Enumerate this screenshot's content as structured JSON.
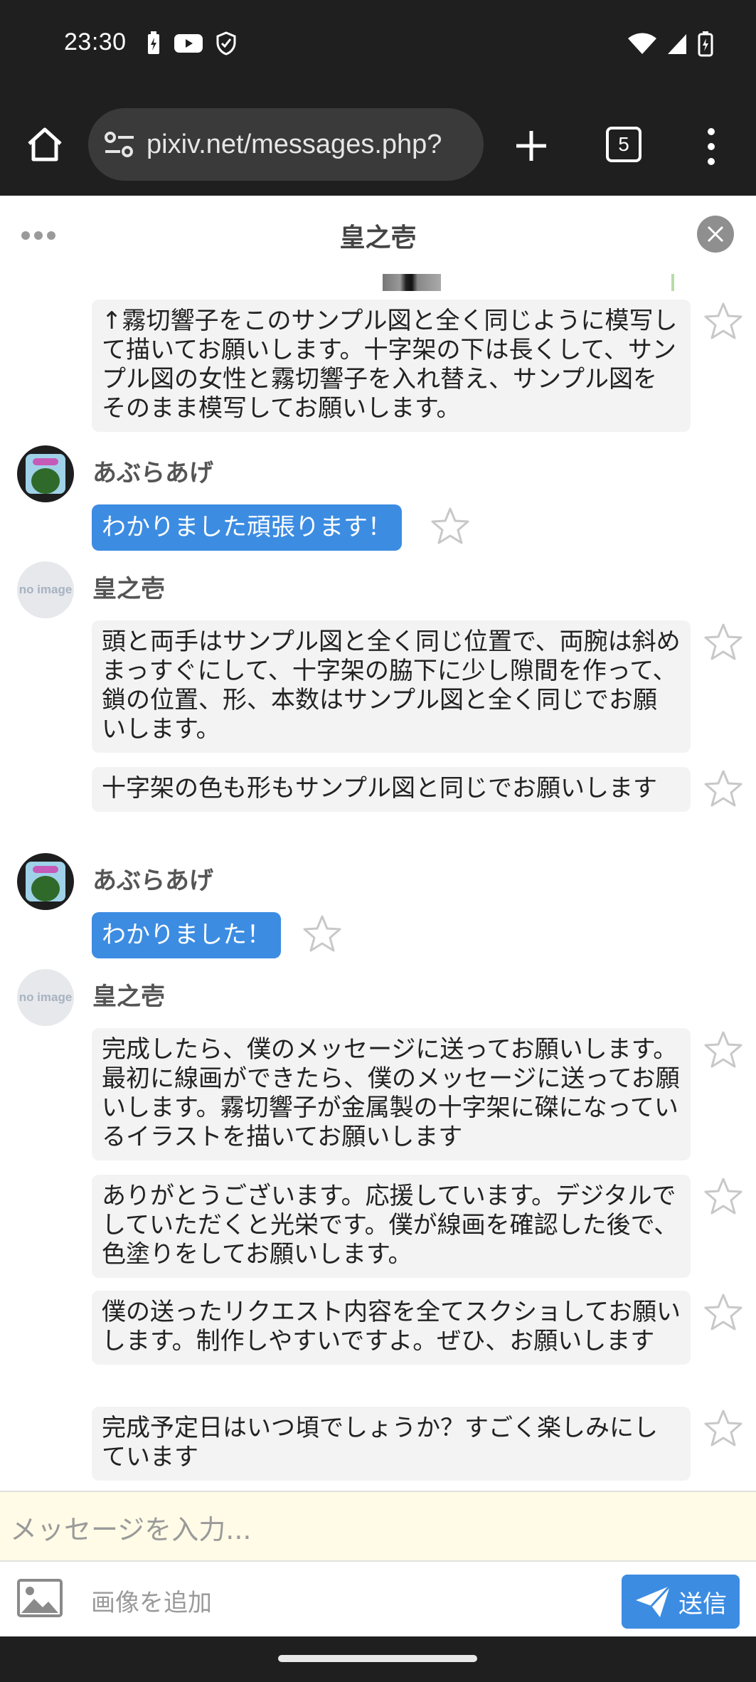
{
  "status_bar": {
    "time": "23:30"
  },
  "browser": {
    "url": "pixiv.net/messages.php?",
    "tab_count": "5"
  },
  "chat": {
    "title": "皇之壱"
  },
  "messages": [
    {
      "text": "↑霧切響子をこのサンプル図と全く同じように模写して描いてお願いします。十字架の下は長くして、サンプル図の女性と霧切響子を入れ替え、サンプル図をそのまま模写してお願いします。"
    },
    {
      "user": "あぶらあげ",
      "text": "わかりました頑張ります！"
    },
    {
      "user": "皇之壱",
      "text": "頭と両手はサンプル図と全く同じ位置で、両腕は斜めまっすぐにして、十字架の脇下に少し隙間を作って、鎖の位置、形、本数はサンプル図と全く同じでお願いします。"
    },
    {
      "text": "十字架の色も形もサンプル図と同じでお願いします"
    },
    {
      "user": "あぶらあげ",
      "text": "わかりました！"
    },
    {
      "user": "皇之壱",
      "text": "完成したら、僕のメッセージに送ってお願いします。最初に線画ができたら、僕のメッセージに送ってお願いします。霧切響子が金属製の十字架に磔になっているイラストを描いてお願いします"
    },
    {
      "text": "ありがとうございます。応援しています。デジタルでしていただくと光栄です。僕が線画を確認した後で、色塗りをしてお願いします。"
    },
    {
      "text": "僕の送ったリクエスト内容を全てスクショしてお願いします。制作しやすいですよ。ぜひ、お願いします"
    },
    {
      "text": "完成予定日はいつ頃でしょうか？すごく楽しみにしています"
    }
  ],
  "avatar_placeholder": "no image",
  "composer": {
    "placeholder": "メッセージを入力...",
    "add_image_label": "画像を追加",
    "send_label": "送信"
  },
  "colors": {
    "accent": "#3c8ce2",
    "bubble": "#f3f3f3",
    "composer_bg": "#fffbe6"
  }
}
